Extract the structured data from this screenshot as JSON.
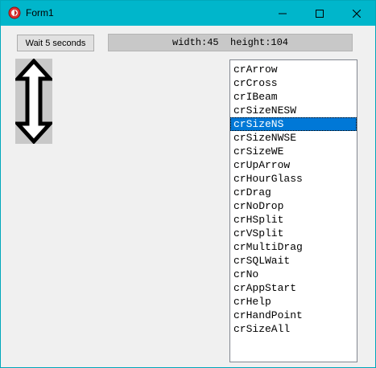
{
  "window": {
    "title": "Form1",
    "accent_color": "#00b6cb",
    "icons": {
      "app": "app-icon",
      "minimize": "minimize-icon",
      "maximize": "maximize-icon",
      "close": "close-icon"
    }
  },
  "toolbar": {
    "wait_button_label": "Wait 5 seconds",
    "size_display": "width:45  height:104"
  },
  "cursor_preview": {
    "icon": "size-ns-cursor-icon",
    "background_color": "#c8c8c8"
  },
  "cursor_list": {
    "selected_index": 4,
    "selected_color": "#0078d7",
    "items": [
      "crArrow",
      "crCross",
      "crIBeam",
      "crSizeNESW",
      "crSizeNS",
      "crSizeNWSE",
      "crSizeWE",
      "crUpArrow",
      "crHourGlass",
      "crDrag",
      "crNoDrop",
      "crHSplit",
      "crVSplit",
      "crMultiDrag",
      "crSQLWait",
      "crNo",
      "crAppStart",
      "crHelp",
      "crHandPoint",
      "crSizeAll"
    ]
  }
}
